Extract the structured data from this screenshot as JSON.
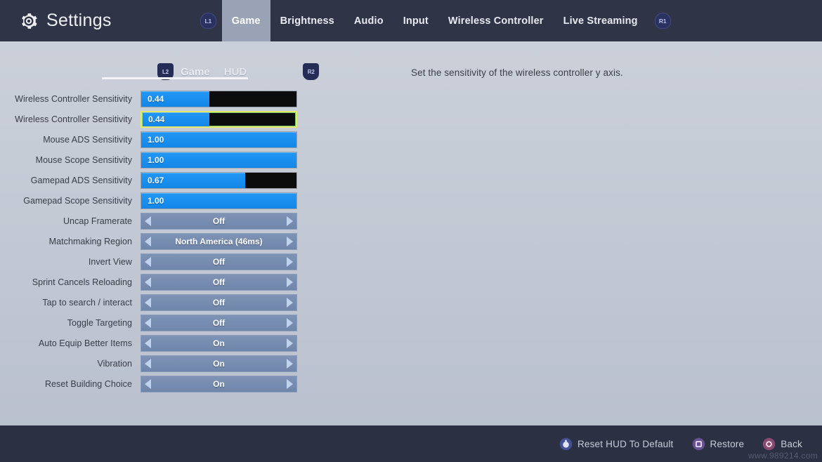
{
  "header": {
    "title": "Settings",
    "gear_icon": "gear-icon",
    "left_bumper": "L1",
    "right_bumper": "R1",
    "tabs": [
      {
        "label": "Game",
        "active": true
      },
      {
        "label": "Brightness",
        "active": false
      },
      {
        "label": "Audio",
        "active": false
      },
      {
        "label": "Input",
        "active": false
      },
      {
        "label": "Wireless Controller",
        "active": false
      },
      {
        "label": "Live Streaming",
        "active": false
      }
    ]
  },
  "subtabs": {
    "left_trigger": "L2",
    "right_trigger": "R2",
    "items": [
      {
        "label": "Game",
        "active": true
      },
      {
        "label": "HUD",
        "active": false
      }
    ]
  },
  "description": "Set the sensitivity of the wireless controller y axis.",
  "settings": [
    {
      "label": "Wireless Controller Sensitivity",
      "type": "slider",
      "value": "0.44",
      "fill_percent": 44,
      "selected": false
    },
    {
      "label": "Wireless Controller Sensitivity",
      "type": "slider",
      "value": "0.44",
      "fill_percent": 44,
      "selected": true
    },
    {
      "label": "Mouse ADS Sensitivity",
      "type": "slider",
      "value": "1.00",
      "fill_percent": 100,
      "selected": false
    },
    {
      "label": "Mouse Scope Sensitivity",
      "type": "slider",
      "value": "1.00",
      "fill_percent": 100,
      "selected": false
    },
    {
      "label": "Gamepad ADS Sensitivity",
      "type": "slider",
      "value": "0.67",
      "fill_percent": 67,
      "selected": false
    },
    {
      "label": "Gamepad Scope Sensitivity",
      "type": "slider",
      "value": "1.00",
      "fill_percent": 100,
      "selected": false
    },
    {
      "label": "Uncap Framerate",
      "type": "selector",
      "value": "Off",
      "selected": false
    },
    {
      "label": "Matchmaking Region",
      "type": "selector",
      "value": "North America (46ms)",
      "selected": false
    },
    {
      "label": "Invert View",
      "type": "selector",
      "value": "Off",
      "selected": false
    },
    {
      "label": "Sprint Cancels Reloading",
      "type": "selector",
      "value": "Off",
      "selected": false
    },
    {
      "label": "Tap to search / interact",
      "type": "selector",
      "value": "Off",
      "selected": false
    },
    {
      "label": "Toggle Targeting",
      "type": "selector",
      "value": "Off",
      "selected": false
    },
    {
      "label": "Auto Equip Better Items",
      "type": "selector",
      "value": "On",
      "selected": false
    },
    {
      "label": "Vibration",
      "type": "selector",
      "value": "On",
      "selected": false
    },
    {
      "label": "Reset Building Choice",
      "type": "selector",
      "value": "On",
      "selected": false
    }
  ],
  "footer": {
    "actions": [
      {
        "label": "Reset HUD To Default",
        "icon": "r3-stick-button-icon",
        "shape": "stick",
        "color": "#5a6bd8"
      },
      {
        "label": "Restore",
        "icon": "square-button-icon",
        "shape": "square",
        "color": "#9b6fd4"
      },
      {
        "label": "Back",
        "icon": "circle-button-icon",
        "shape": "circle",
        "color": "#d95f96"
      }
    ]
  },
  "watermark": "www.989214.com",
  "colors": {
    "topbar": "#2f3446",
    "footer": "#2b3043",
    "slider_fill": "#1a8fef",
    "slider_track": "#0c0c0c",
    "selector_fill": "#768cb0",
    "selection_border": "#e8e86a",
    "active_tab_bg": "#9aa3b6"
  }
}
